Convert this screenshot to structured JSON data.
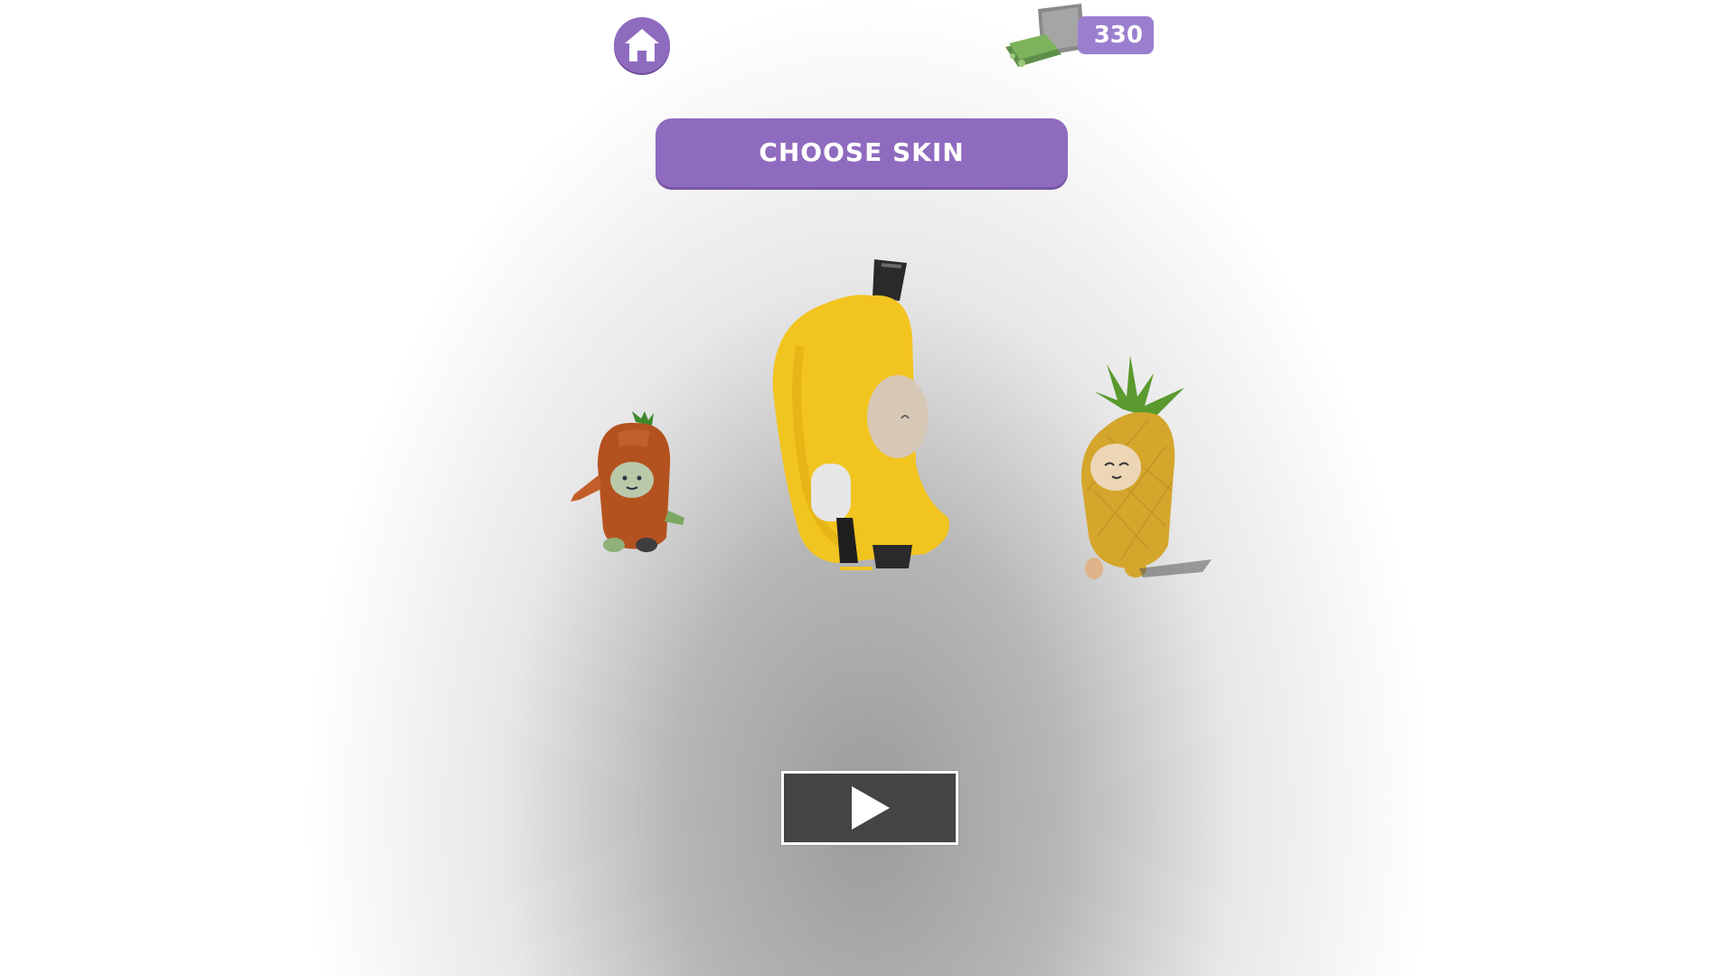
{
  "header": {
    "home_icon": "home-icon",
    "currency_icon": "cash-stack-icon",
    "coins": "330"
  },
  "title": "CHOOSE SKIN",
  "skins": [
    {
      "name": "carrot",
      "icon": "carrot-character"
    },
    {
      "name": "banana",
      "icon": "banana-character",
      "selected": true
    },
    {
      "name": "pineapple",
      "icon": "pineapple-character"
    }
  ],
  "play_icon": "play-icon",
  "colors": {
    "accent": "#8f6bbf",
    "coins_bg": "#9b7fcf",
    "play_bg": "#444444"
  }
}
